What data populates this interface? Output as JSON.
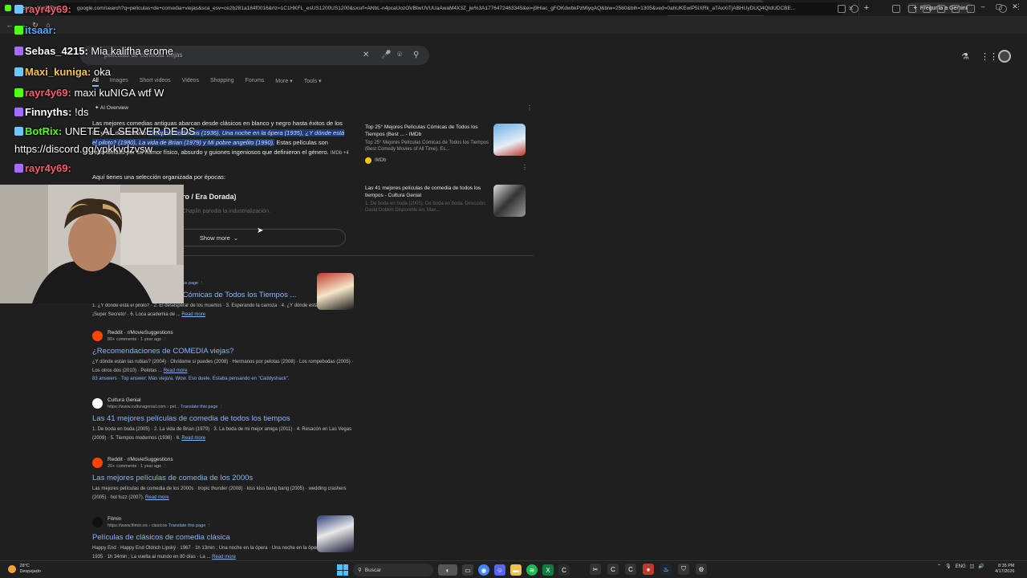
{
  "tabs": [
    {
      "title": "Stream - Kick Dmitripe...",
      "color": "#53fc18",
      "active": false
    },
    {
      "title": "matumorell Stream - Watch Live...",
      "color": "#53fc18",
      "active": false
    },
    {
      "title": "Saddey Stream - Watch Live o...",
      "color": "#53fc18",
      "active": false
    },
    {
      "title": "Bananirou Stream - Watch Live...",
      "color": "#53fc18",
      "active": false
    },
    {
      "title": "zmattyy Stream - Watch Live o...",
      "color": "#53fc18",
      "active": false
    },
    {
      "title": "Interacción | El mejor software...",
      "color": "#ffffff",
      "active": false
    },
    {
      "title": "Pin on ipad",
      "color": "#e60023",
      "active": false
    },
    {
      "title": "peliculas de comedia viejas - G...",
      "color": "#4285f4",
      "active": true
    },
    {
      "title": "Awesome New Tab Page",
      "color": "#4a90e2",
      "active": false
    }
  ],
  "browser": {
    "new_tab": "+",
    "gemini": "Pregunta a Gemini",
    "url": "google.com/search?q=peliculas+de+comedia+viejas&sca_esv=ce2b281a184f0016&rlz=1C1HKFL_esUS1200US1200&sxsrf=ANbL-n4pcaUozOVBtwUVUUaAwaM4X3Z_jw%3A1776472463345&ei=j9Hiac_gFOKdwbkPzMiyqAQ&biw=2560&bih=1305&ved=0ahUKEwiP5IXRk_aTAxXiTjABHUyDUQ4QIdUDCBE..."
  },
  "search": {
    "query": "peliculas de comedia viejas",
    "filters": [
      "All",
      "Images",
      "Short videos",
      "Videos",
      "Shopping",
      "Forums",
      "More ▾",
      "Tools ▾"
    ]
  },
  "ai_overview": {
    "label": "AI Overview",
    "intro_a": "Las mejores comedias antiguas abarcan desde clásicos en blanco y negro hasta éxitos de los 80 y 90, destacando ",
    "intro_hl": "Tiempos modernos (1936), Una noche en la ópera (1935), ¿Y dónde está el piloto? (1980), La vida de Brian (1979) y Mi pobre angelito (1990).",
    "intro_b": " Estas películas son reconocidas por su humor físico, absurdo y guiones ingeniosos que definieron el género.",
    "intro_src": "IMDb +4",
    "sub": "Aquí tienes una selección organizada por épocas:",
    "era": "Clásicos del Blanco y Negro / Era Dorada)",
    "fade": "Tiempos modernos (1936): Charles Chaplin parodia la industrialización.",
    "show_more": "Show more",
    "cards": [
      {
        "title": "Top 25° Mejores Películas Cómicas de Todos los Tiempos (Best ... - IMDb",
        "desc": "Top 25° Mejores Películas Cómicas de Todos los Tiempos (Best Comedy Movies of All Time). Es...",
        "source": "IMDb"
      },
      {
        "title": "Las 41 mejores películas de comedia de todos los tiempos - Cultura Genial",
        "desc": "1. De boda en boda (2005). De boda en boda. Dirección: David Dobkin Disponible en: Max..."
      }
    ]
  },
  "results": [
    {
      "site": "IMDb",
      "url": "https://www.imdb.com › list",
      "translate": "Translate this page",
      "title": "Top 25° Mejores Películas Cómicas de Todos los Tiempos ...",
      "snippet": "1. ¿Y dónde está el piloto? · 2. El desesperar de los muertos · 3. Esperando la carroza · 4. ¿Y dónde está el policía? · 5. ¡Super Secreto! · 6. Loca academia de ...",
      "read_more": "Read more",
      "answers": ""
    },
    {
      "site": "Reddit · r/MovieSuggestions",
      "url": "80+ comments · 1 year ago",
      "translate": "",
      "title": "¿Recomendaciones de COMEDIA viejas?",
      "snippet": "¿Y dónde están las rubias? (2004) · Olvídame si puedes (2008) · Hermanos por pelotas (2008) · Los rompebodas (2005) · Los otros dos (2010) · Pelotas ...",
      "read_more": "Read more",
      "answers": "83 answers · Top answer: Más viejo/a. Wow. Eso duele. Estaba pensando en \"Caddyshack\"."
    },
    {
      "site": "Cultura Genial",
      "url": "https://www.culturagenial.com › pel...",
      "translate": "Translate this page",
      "title": "Las 41 mejores películas de comedia de todos los tiempos",
      "snippet": "1. De boda en boda (2005) · 2. La vida de Brian (1979) · 3. La boda de mi mejor amiga (2011) · 4. Resacón en Las Vegas (2009) · 5. Tiempos modernos (1936) · 6.",
      "read_more": "Read more",
      "answers": ""
    },
    {
      "site": "Reddit · r/MovieSuggestions",
      "url": "20+ comments · 1 year ago",
      "translate": "",
      "title": "Las mejores películas de comedia de los 2000s",
      "snippet": "Las mejores películas de comedia de los 2000s · tropic thunder (2008) · kiss kiss bang bang (2005) · wedding crashers (2005) · hot fuzz (2007).",
      "read_more": "Read more",
      "answers": ""
    },
    {
      "site": "Filmin",
      "url": "https://www.filmin.es › clasicos",
      "translate": "Translate this page",
      "title": "Películas de clásicos de comedia clásica",
      "snippet": "Happy End · Happy End Oldrich Lipský · 1967 · 1h 13min ; Una noche en la ópera · Una noche en la ópera Sam Wood · 1935 · 1h 34min ; La vuelta al mundo en 80 días · La ...",
      "read_more": "Read more",
      "answers": ""
    }
  ],
  "chat": [
    {
      "user": "rayr4y69:",
      "msg": "",
      "color": "#ff5a6e"
    },
    {
      "user": "itsaar:",
      "msg": "",
      "color": "#5aa7ff"
    },
    {
      "user": "Sebas_4215:",
      "msg": "Mia kalifha erome",
      "color": "#ffffff"
    },
    {
      "user": "Maxi_kuniga:",
      "msg": "oka",
      "color": "#f5c542"
    },
    {
      "user": "rayr4y69:",
      "msg": "maxi kuNIGA wtf W",
      "color": "#ff5a6e"
    },
    {
      "user": "Finnyths:",
      "msg": "!ds",
      "color": "#ffffff"
    },
    {
      "user": "BotRix:",
      "msg": "UNETE AL SERVER DE DS",
      "color": "#53fc18"
    },
    {
      "user": "",
      "msg": "https://discord.gg/ypkkvdzvsw",
      "color": "#ffffff"
    },
    {
      "user": "rayr4y69:",
      "msg": "",
      "color": "#ff5a6e"
    }
  ],
  "taskbar": {
    "temp": "28°C",
    "weather": "Despejado",
    "search": "Buscar",
    "lang": "ENG",
    "time": "8:35 PM",
    "date": "4/17/2026"
  }
}
